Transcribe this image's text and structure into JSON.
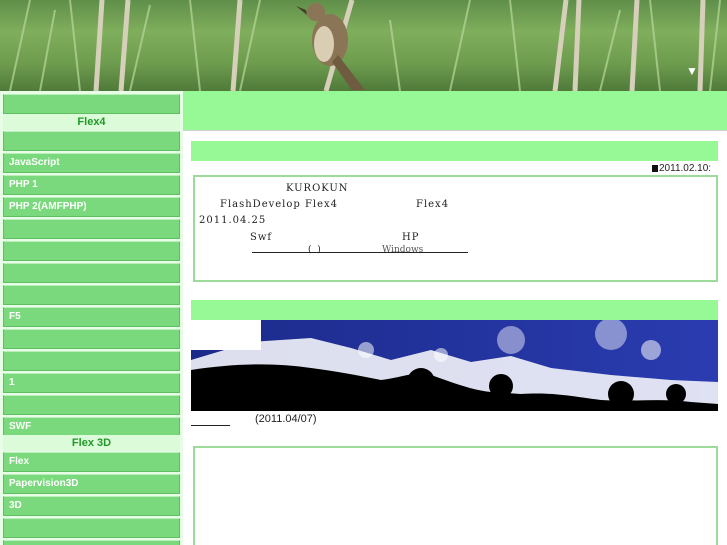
{
  "header": {
    "arrow_icon": "▼"
  },
  "sidebar": {
    "items": [
      {
        "label": ""
      },
      {
        "label": ""
      },
      {
        "label": "JavaScript"
      },
      {
        "label": "PHP    1"
      },
      {
        "label": "PHP    2(AMFPHP)"
      },
      {
        "label": ""
      },
      {
        "label": ""
      },
      {
        "label": ""
      },
      {
        "label": ""
      },
      {
        "label": "F5"
      },
      {
        "label": ""
      },
      {
        "label": ""
      },
      {
        "label": "1"
      },
      {
        "label": ""
      },
      {
        "label": "  SWF"
      },
      {
        "label": "Flex"
      },
      {
        "label": "Papervision3D"
      },
      {
        "label": "3D"
      },
      {
        "label": ""
      },
      {
        "label": ""
      }
    ],
    "headings": [
      "Flex4",
      "Flex 3D"
    ]
  },
  "post": {
    "date": "2011.02.10:",
    "line1": "KUROKUN",
    "line2": "FlashDevelop Flex4",
    "line2b": "Flex4",
    "line3": "2011.04.25",
    "line4a": "Swf",
    "line4b": "HP",
    "link_paren": "(  )",
    "link_windows": "Windows"
  },
  "post2": {
    "caption": "(2011.04/07)"
  },
  "colors": {
    "menu": "#7ad97c",
    "heading_text": "#1f9a26",
    "bar": "#97f896"
  }
}
